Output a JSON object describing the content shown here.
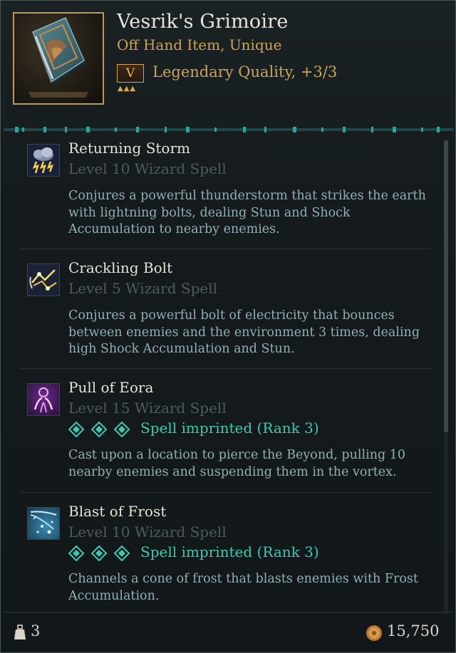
{
  "item": {
    "name": "Vesrik's Grimoire",
    "type": "Off Hand Item, Unique",
    "rank_letter": "V",
    "quality": "Legendary Quality, +3/3",
    "portrait_icon": "grimoire-book-icon"
  },
  "spells": [
    {
      "name": "Returning Storm",
      "level": "Level 10 Wizard Spell",
      "imprint": "",
      "description": "Conjures a powerful thunderstorm that strikes the earth with lightning bolts, dealing Stun and Shock Accumulation to nearby enemies.",
      "icon": "storm-cloud-lightning-icon"
    },
    {
      "name": "Crackling Bolt",
      "level": "Level 5 Wizard Spell",
      "imprint": "",
      "description": "Conjures a powerful bolt of electricity that bounces between enemies and the environment 3 times, dealing high Shock Accumulation and Stun.",
      "icon": "chain-lightning-icon"
    },
    {
      "name": "Pull of Eora",
      "level": "Level 15 Wizard Spell",
      "imprint": "Spell imprinted (Rank 3)",
      "description": "Cast upon a location to pierce the Beyond, pulling 10 nearby enemies and suspending them in the vortex.",
      "icon": "vortex-pull-icon"
    },
    {
      "name": "Blast of Frost",
      "level": "Level 10 Wizard Spell",
      "imprint": "Spell imprinted (Rank 3)",
      "description": "Channels a cone of frost that blasts enemies with Frost Accumulation.",
      "icon": "frost-cone-icon"
    }
  ],
  "footer": {
    "weight": "3",
    "price": "15,750"
  },
  "colors": {
    "gold": "#c9a45a",
    "imprint_teal": "#3bc9b0",
    "desc_blue": "#8fb1b4",
    "muted_gray": "#4f5a5c"
  }
}
